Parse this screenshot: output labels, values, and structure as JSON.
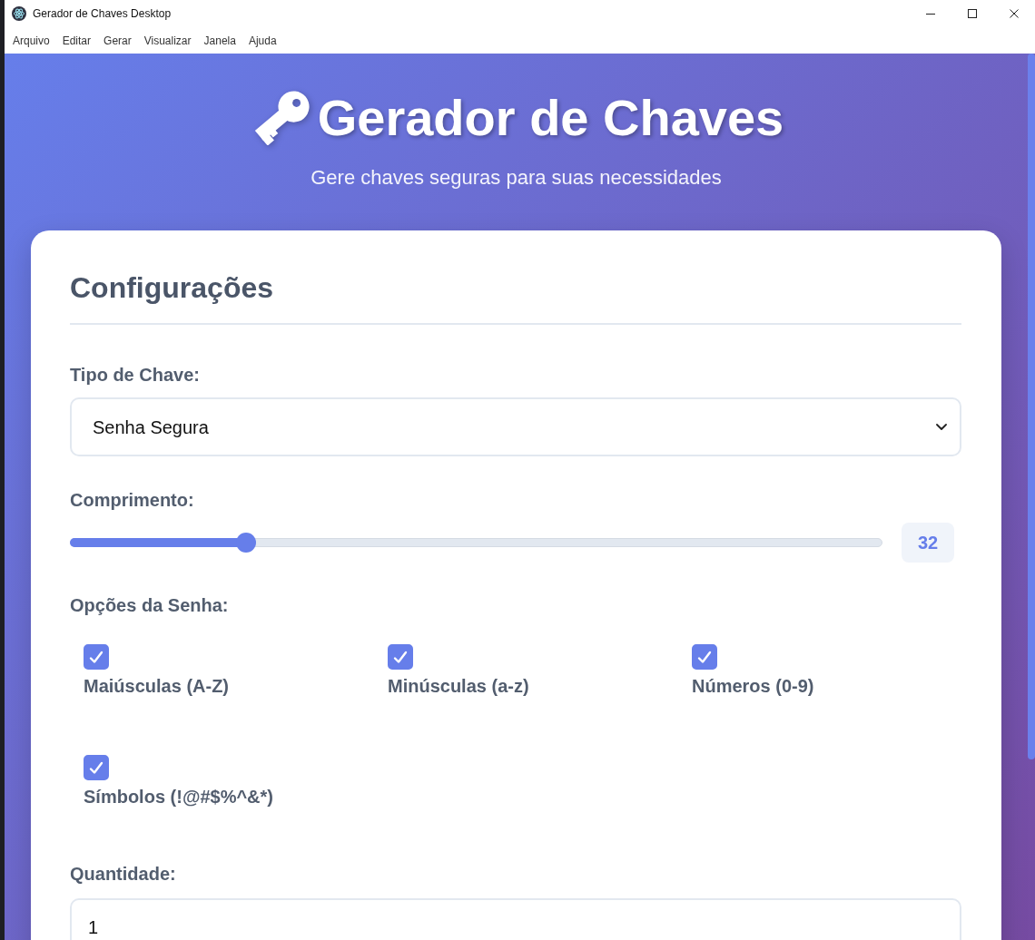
{
  "window": {
    "title": "Gerador de Chaves Desktop"
  },
  "menu": [
    "Arquivo",
    "Editar",
    "Gerar",
    "Visualizar",
    "Janela",
    "Ajuda"
  ],
  "header": {
    "title": "Gerador de Chaves",
    "subtitle": "Gere chaves seguras para suas necessidades"
  },
  "settings": {
    "heading": "Configurações",
    "fields": [
      {
        "kind": "select",
        "label": "Tipo de Chave:",
        "value": "Senha Segura"
      },
      {
        "kind": "slider",
        "label": "Comprimento:",
        "level": 0.21,
        "reading": "32"
      },
      {
        "kind": "checkboxes",
        "label": "Opções da Senha:",
        "options": [
          {
            "label": "Maiúsculas (A-Z)",
            "checked": true
          },
          {
            "label": "Minúsculas (a-z)",
            "checked": true
          },
          {
            "label": "Números (0-9)",
            "checked": true
          },
          {
            "label": "Símbolos (!@#$%^&*)",
            "checked": true
          }
        ]
      },
      {
        "kind": "input",
        "label": "Quantidade:",
        "value": "1"
      }
    ]
  }
}
